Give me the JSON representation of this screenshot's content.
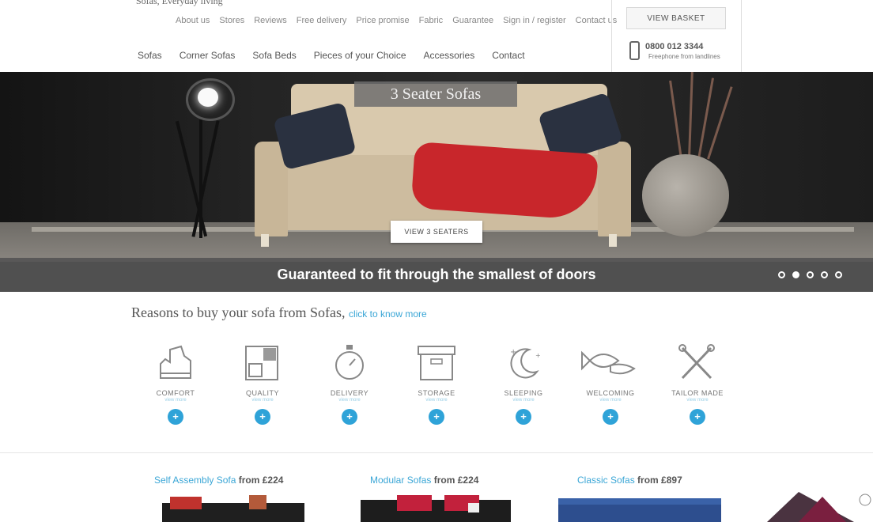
{
  "header": {
    "tagline": "Sofas, Everyday living",
    "top_nav": [
      "About us",
      "Stores",
      "Reviews",
      "Free delivery",
      "Price promise",
      "Fabric",
      "Guarantee",
      "Sign in / register",
      "Contact us"
    ],
    "main_nav": [
      "Sofas",
      "Corner Sofas",
      "Sofa Beds",
      "Pieces of your Choice",
      "Accessories",
      "Contact"
    ],
    "basket_label": "VIEW BASKET",
    "phone_number": "0800 012 3344",
    "phone_sub": "Freephone from landlines"
  },
  "hero": {
    "title": "3 Seater Sofas",
    "cta": "VIEW 3 SEATERS",
    "caption": "Guaranteed to fit through the smallest of doors",
    "slides_total": 5,
    "active_slide": 2
  },
  "reasons": {
    "title": "Reasons to buy your sofa from Sofas,",
    "link": "click to know more",
    "items": [
      {
        "title": "COMFORT",
        "sub": "view more",
        "icon": "sofa-icon"
      },
      {
        "title": "QUALITY",
        "sub": "view more",
        "icon": "frame-icon"
      },
      {
        "title": "DELIVERY",
        "sub": "view more",
        "icon": "stopwatch-icon"
      },
      {
        "title": "STORAGE",
        "sub": "view more",
        "icon": "box-icon"
      },
      {
        "title": "SLEEPING",
        "sub": "view more",
        "icon": "moon-icon"
      },
      {
        "title": "WELCOMING",
        "sub": "view more",
        "icon": "fish-icon"
      },
      {
        "title": "TAILOR MADE",
        "sub": "view more",
        "icon": "scissors-icon"
      }
    ]
  },
  "products": [
    {
      "name": "Self Assembly Sofa",
      "price": "from £224"
    },
    {
      "name": "Modular Sofas",
      "price": "from £224"
    },
    {
      "name": "Classic Sofas",
      "price": "from £897"
    }
  ],
  "colors": {
    "accent": "#2fa3d8",
    "link": "#3aa6d6",
    "throw": "#c8262b"
  }
}
